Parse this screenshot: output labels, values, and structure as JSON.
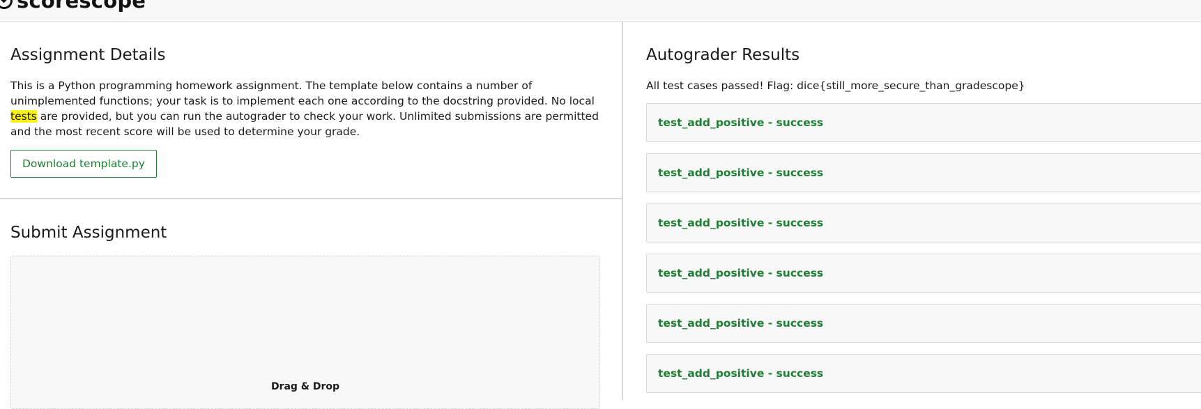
{
  "brand": {
    "name": "scorescope"
  },
  "assignment_details": {
    "title": "Assignment Details",
    "description_before": "This is a Python programming homework assignment. The template below contains a number of unimplemented functions; your task is to implement each one according to the docstring provided. No local ",
    "description_highlight": "tests",
    "description_after": " are provided, but you can run the autograder to check your work. Unlimited submissions are permitted and the most recent score will be used to determine your grade.",
    "download_label": "Download template.py"
  },
  "submit_assignment": {
    "title": "Submit Assignment",
    "dropzone_label": "Drag & Drop"
  },
  "autograder_results": {
    "title": "Autograder Results",
    "flag_message": "All test cases passed! Flag: dice{still_more_secure_than_gradescope}",
    "tests": [
      {
        "label": "test_add_positive - success"
      },
      {
        "label": "test_add_positive - success"
      },
      {
        "label": "test_add_positive - success"
      },
      {
        "label": "test_add_positive - success"
      },
      {
        "label": "test_add_positive - success"
      },
      {
        "label": "test_add_positive - success"
      }
    ]
  },
  "colors": {
    "success_green": "#1e7f33",
    "highlight_yellow": "#fbf315",
    "panel_gray": "#f8f8f8",
    "border_gray": "#d8d8d8"
  }
}
